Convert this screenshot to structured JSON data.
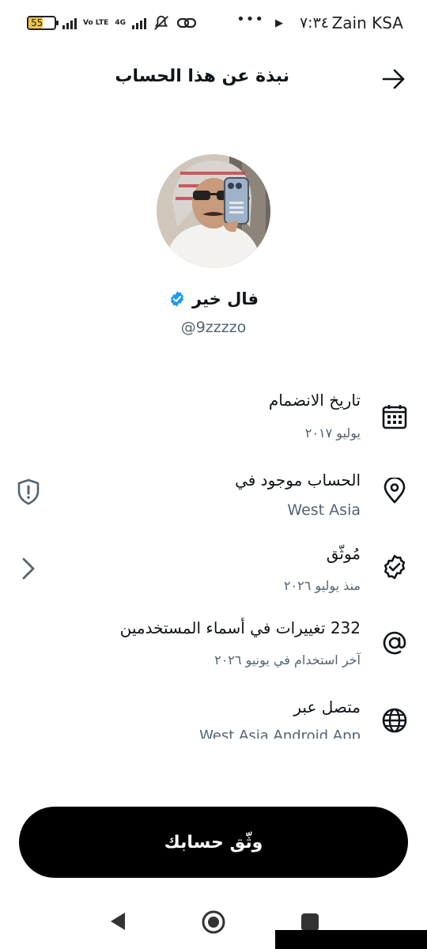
{
  "status_bar": {
    "carrier": "Zain KSA",
    "time": "٧:٣٤",
    "battery": "55",
    "battery_level": 0.55,
    "network_tags": [
      "Vo LTE",
      "4G"
    ],
    "more": "•••"
  },
  "header": {
    "title": "نبذة عن هذا الحساب",
    "back_icon": "arrow-right-icon"
  },
  "profile": {
    "name": "فال خير",
    "handle": "@9zzzzo",
    "verified_color": "#1d9bf0"
  },
  "rows": [
    {
      "title": "تاريخ الانضمام",
      "subtitle": "يوليو ٢٠١٧",
      "icon": "calendar-icon"
    },
    {
      "title": "الحساب موجود في",
      "subtitle": "West Asia",
      "icon": "location-pin-icon",
      "side_icon": "shield-alert-icon"
    },
    {
      "title": "مُوثّق",
      "subtitle": "منذ يوليو ٢٠٢٦",
      "icon": "verified-badge-icon",
      "side_icon": "chevron-right-icon"
    },
    {
      "title": "232 تغييرات في أسماء المستخدمين",
      "subtitle": "آخر استخدام في يونيو ٢٠٢٦",
      "icon": "at-sign-icon"
    },
    {
      "title": "متصل عبر",
      "subtitle": "West Asia Android App",
      "icon": "globe-icon"
    }
  ],
  "cta": {
    "label": "وثّق حسابك"
  },
  "colors": {
    "text": "#0f1419",
    "muted": "#536471",
    "accent": "#1d9bf0",
    "button": "#000000"
  }
}
